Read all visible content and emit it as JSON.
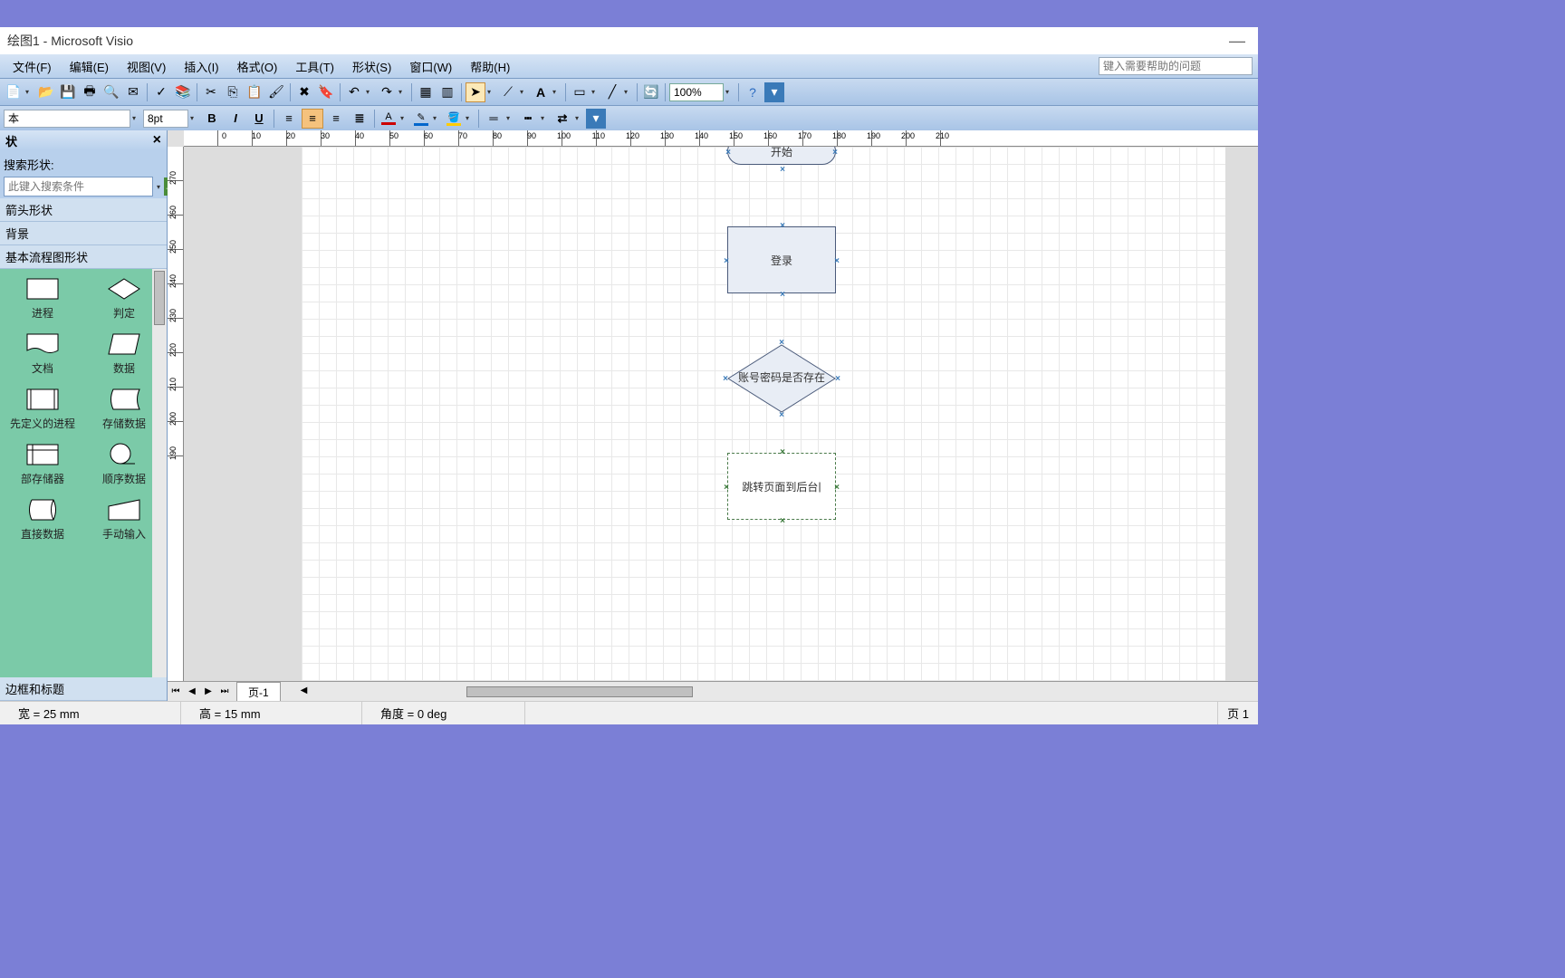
{
  "window": {
    "title": "绘图1 - Microsoft Visio"
  },
  "menu": {
    "file": "文件(F)",
    "edit": "编辑(E)",
    "view": "视图(V)",
    "insert": "插入(I)",
    "format": "格式(O)",
    "tools": "工具(T)",
    "shape": "形状(S)",
    "window": "窗口(W)",
    "help": "帮助(H)",
    "help_placeholder": "键入需要帮助的问题"
  },
  "toolbar": {
    "zoom": "100%"
  },
  "format": {
    "font": "本",
    "size": "8pt"
  },
  "shapes_panel": {
    "title": "状",
    "search_label": "搜索形状:",
    "search_placeholder": "此键入搜索条件",
    "categories": [
      "箭头形状",
      "背景",
      "基本流程图形状",
      "边框和标题"
    ],
    "shapes": [
      {
        "name": "进程",
        "icon": "rect"
      },
      {
        "name": "判定",
        "icon": "diamond"
      },
      {
        "name": "文档",
        "icon": "doc"
      },
      {
        "name": "数据",
        "icon": "para"
      },
      {
        "name": "先定义的进程",
        "icon": "predef"
      },
      {
        "name": "存储数据",
        "icon": "stored"
      },
      {
        "name": "部存储器",
        "icon": "intstore"
      },
      {
        "name": "顺序数据",
        "icon": "seq"
      },
      {
        "name": "直接数据",
        "icon": "direct"
      },
      {
        "name": "手动输入",
        "icon": "manual"
      }
    ]
  },
  "canvas": {
    "shapes": {
      "start": "开始",
      "login": "登录",
      "decision": "账号密码是否存在",
      "editing": "跳转页面到后台"
    },
    "ruler_h": [
      "0",
      "10",
      "20",
      "30",
      "40",
      "50",
      "60",
      "70",
      "80",
      "90",
      "100",
      "110",
      "120",
      "130",
      "140",
      "150",
      "160",
      "170",
      "180",
      "190",
      "200",
      "210"
    ],
    "ruler_v": [
      "270",
      "260",
      "250",
      "240",
      "230",
      "220",
      "210",
      "200",
      "190"
    ]
  },
  "pagetab": {
    "page1": "页-1"
  },
  "status": {
    "width": "宽 = 25 mm",
    "height": "高 = 15 mm",
    "angle": "角度 = 0 deg",
    "page": "页 1"
  }
}
